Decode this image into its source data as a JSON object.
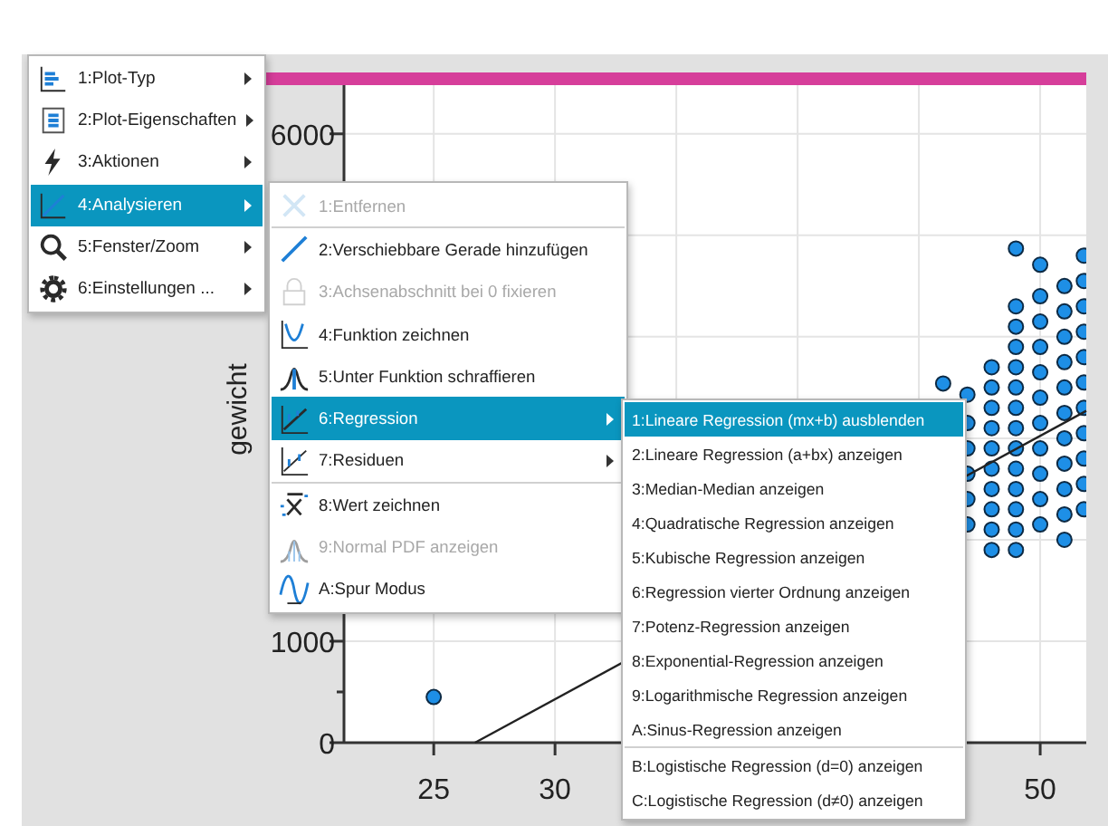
{
  "plot": {
    "chart_data": {
      "type": "scatter",
      "ylabel": "gewicht",
      "x": [
        25,
        46,
        47,
        47,
        47,
        47,
        47,
        47,
        48,
        48,
        48,
        48,
        48,
        48,
        48,
        48,
        48,
        48,
        49,
        49,
        49,
        49,
        49,
        49,
        49,
        49,
        49,
        49,
        49,
        49,
        49,
        49,
        50,
        50,
        50,
        50,
        50,
        50,
        50,
        50,
        50,
        50,
        50,
        51,
        51,
        51,
        51,
        51,
        51,
        51,
        51,
        51,
        51,
        51,
        51.8,
        51.8,
        51.8,
        51.8,
        51.8,
        51.8,
        51.8,
        51.8,
        51.8,
        51.8,
        51.8
      ],
      "series": [
        {
          "color": "#1e8fe6",
          "values": [
            450,
            3540,
            3430,
            3150,
            2900,
            2650,
            2400,
            2150,
            3700,
            3500,
            3300,
            3100,
            2900,
            2700,
            2500,
            2300,
            2100,
            1900,
            4870,
            4300,
            4100,
            3900,
            3700,
            3500,
            3300,
            3100,
            2900,
            2700,
            2500,
            2300,
            2100,
            1900,
            4710,
            4400,
            4150,
            3900,
            3650,
            3400,
            3150,
            2900,
            2650,
            2400,
            2150,
            4500,
            4250,
            4000,
            3750,
            3500,
            3250,
            3000,
            2750,
            2500,
            2250,
            2000,
            4800,
            4550,
            4300,
            4050,
            3800,
            3550,
            3300,
            3050,
            2800,
            2550,
            2300
          ]
        }
      ],
      "xlim": [
        21.3,
        51.9
      ],
      "ylim": [
        0,
        6480
      ],
      "xticks": [
        25,
        30,
        50
      ],
      "yticks": [
        0,
        1000,
        6000
      ],
      "grid": true
    }
  },
  "main_menu": {
    "items": [
      {
        "label": "1:Plot-Typ",
        "selected": false,
        "has_submenu": true
      },
      {
        "label": "2:Plot-Eigenschaften",
        "selected": false,
        "has_submenu": true
      },
      {
        "label": "3:Aktionen",
        "selected": false,
        "has_submenu": true
      },
      {
        "label": "4:Analysieren",
        "selected": true,
        "has_submenu": true
      },
      {
        "label": "5:Fenster/Zoom",
        "selected": false,
        "has_submenu": true
      },
      {
        "label": "6:Einstellungen ...",
        "selected": false,
        "has_submenu": true
      }
    ]
  },
  "analysis_menu": {
    "items": [
      {
        "label": "1:Entfernen",
        "selected": false,
        "disabled": true,
        "has_submenu": false,
        "separator_before": false
      },
      {
        "label": "2:Verschiebbare Gerade hinzufügen",
        "selected": false,
        "disabled": false,
        "has_submenu": false,
        "separator_before": true
      },
      {
        "label": "3:Achsenabschnitt bei 0 fixieren",
        "selected": false,
        "disabled": true,
        "has_submenu": false,
        "separator_before": false
      },
      {
        "label": "4:Funktion zeichnen",
        "selected": false,
        "disabled": false,
        "has_submenu": false,
        "separator_before": false
      },
      {
        "label": "5:Unter Funktion schraffieren",
        "selected": false,
        "disabled": false,
        "has_submenu": false,
        "separator_before": false
      },
      {
        "label": "6:Regression",
        "selected": true,
        "disabled": false,
        "has_submenu": true,
        "separator_before": false
      },
      {
        "label": "7:Residuen",
        "selected": false,
        "disabled": false,
        "has_submenu": true,
        "separator_before": false
      },
      {
        "label": "8:Wert zeichnen",
        "selected": false,
        "disabled": false,
        "has_submenu": false,
        "separator_before": true
      },
      {
        "label": "9:Normal PDF anzeigen",
        "selected": false,
        "disabled": true,
        "has_submenu": false,
        "separator_before": false
      },
      {
        "label": "A:Spur Modus",
        "selected": false,
        "disabled": false,
        "has_submenu": false,
        "separator_before": false
      }
    ]
  },
  "regression_menu": {
    "items": [
      {
        "label": "1:Lineare Regression (mx+b) ausblenden",
        "selected": true,
        "separator_before": false
      },
      {
        "label": "2:Lineare Regression (a+bx) anzeigen",
        "selected": false,
        "separator_before": false
      },
      {
        "label": "3:Median-Median anzeigen",
        "selected": false,
        "separator_before": false
      },
      {
        "label": "4:Quadratische Regression anzeigen",
        "selected": false,
        "separator_before": false
      },
      {
        "label": "5:Kubische Regression anzeigen",
        "selected": false,
        "separator_before": false
      },
      {
        "label": "6:Regression vierter Ordnung anzeigen",
        "selected": false,
        "separator_before": false
      },
      {
        "label": "7:Potenz-Regression anzeigen",
        "selected": false,
        "separator_before": false
      },
      {
        "label": "8:Exponential-Regression anzeigen",
        "selected": false,
        "separator_before": false
      },
      {
        "label": "9:Logarithmische Regression anzeigen",
        "selected": false,
        "separator_before": false
      },
      {
        "label": "A:Sinus-Regression anzeigen",
        "selected": false,
        "separator_before": false
      },
      {
        "label": "B:Logistische Regression (d=0) anzeigen",
        "selected": false,
        "separator_before": true
      },
      {
        "label": "C:Logistische Regression (d≠0) anzeigen",
        "selected": false,
        "separator_before": false
      }
    ]
  }
}
